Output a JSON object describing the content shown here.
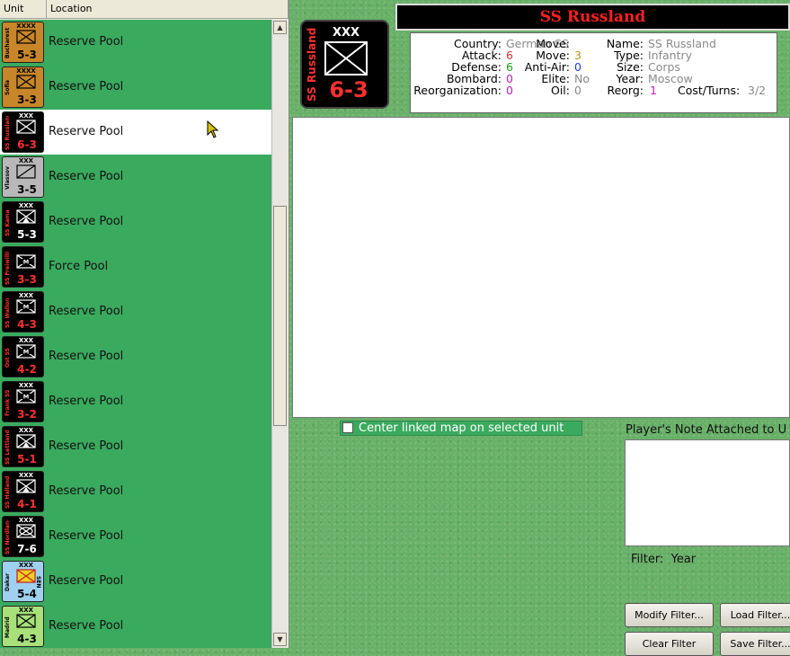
{
  "list": {
    "columns": {
      "unit": "Unit",
      "location": "Location"
    },
    "rows": [
      {
        "location": "Reserve Pool",
        "counter": {
          "name": "Bucharest",
          "size": "XXXX",
          "str": "5-3",
          "side": "",
          "bg": "#c8862a",
          "fg": "#000000",
          "strColor": "#000000",
          "symbol": "infantry"
        }
      },
      {
        "location": "Reserve Pool",
        "counter": {
          "name": "Sofia",
          "size": "XXXX",
          "str": "3-3",
          "side": "",
          "bg": "#c8862a",
          "fg": "#000000",
          "strColor": "#000000",
          "symbol": "infantry"
        }
      },
      {
        "location": "Reserve Pool",
        "counter": {
          "name": "SS Russland",
          "size": "XXX",
          "str": "6-3",
          "side": "",
          "bg": "#000000",
          "fg": "#ffffff",
          "strColor": "#ff3030",
          "symbol": "infantry"
        }
      },
      {
        "location": "Reserve Pool",
        "counter": {
          "name": "Vlassov",
          "size": "XXX",
          "str": "3-5",
          "side": "",
          "bg": "#b8b8b8",
          "fg": "#000000",
          "strColor": "#000000",
          "symbol": "cavalry"
        }
      },
      {
        "location": "Reserve Pool",
        "counter": {
          "name": "SS Kama",
          "size": "XXX",
          "str": "5-3",
          "side": "",
          "bg": "#000000",
          "fg": "#ffffff",
          "strColor": "#ffffff",
          "symbol": "mountain"
        }
      },
      {
        "location": "Force Pool",
        "counter": {
          "name": "SS Freiwilli",
          "size": "",
          "str": "3-3",
          "side": "",
          "bg": "#000000",
          "fg": "#ffffff",
          "strColor": "#ff3030",
          "symbol": "motorized"
        }
      },
      {
        "location": "Reserve Pool",
        "counter": {
          "name": "SS Wallon",
          "size": "XXX",
          "str": "4-3",
          "side": "",
          "bg": "#000000",
          "fg": "#ffffff",
          "strColor": "#ff3030",
          "symbol": "motorized"
        }
      },
      {
        "location": "Reserve Pool",
        "counter": {
          "name": "Ost SS",
          "size": "XXX",
          "str": "4-2",
          "side": "",
          "bg": "#000000",
          "fg": "#ffffff",
          "strColor": "#ff3030",
          "symbol": "motorized"
        }
      },
      {
        "location": "Reserve Pool",
        "counter": {
          "name": "Frank SS",
          "size": "XXX",
          "str": "3-2",
          "side": "",
          "bg": "#000000",
          "fg": "#ffffff",
          "strColor": "#ff3030",
          "symbol": "motorized"
        }
      },
      {
        "location": "Reserve Pool",
        "counter": {
          "name": "SS Lettland",
          "size": "XXX",
          "str": "5-1",
          "side": "",
          "bg": "#000000",
          "fg": "#ffffff",
          "strColor": "#ff3030",
          "symbol": "mountain"
        }
      },
      {
        "location": "Reserve Pool",
        "counter": {
          "name": "SS Halland",
          "size": "XXX",
          "str": "4-1",
          "side": "",
          "bg": "#000000",
          "fg": "#ffffff",
          "strColor": "#ff3030",
          "symbol": "mountain"
        }
      },
      {
        "location": "Reserve Pool",
        "counter": {
          "name": "SS Nordland",
          "size": "XXX",
          "str": "7-6",
          "side": "",
          "bg": "#000000",
          "fg": "#ffffff",
          "strColor": "#ffffff",
          "symbol": "armor"
        }
      },
      {
        "location": "Reserve Pool",
        "counter": {
          "name": "Dakar",
          "size": "XXX",
          "str": "5-4",
          "side": "SEN",
          "bg": "#9fd0ef",
          "fg": "#000000",
          "strColor": "#000000",
          "symbol": "colonial"
        }
      },
      {
        "location": "Reserve Pool",
        "counter": {
          "name": "Madrid",
          "size": "XXX",
          "str": "4-3",
          "side": "",
          "bg": "#a8e07a",
          "fg": "#000000",
          "strColor": "#000000",
          "symbol": "infantry"
        }
      }
    ]
  },
  "selected": {
    "title": "SS Russland",
    "counter": {
      "name": "SS Russland",
      "size": "XXX",
      "str": "6-3"
    },
    "fields": {
      "country_label": "Country:",
      "country": "German SS",
      "attack_label": "Attack:",
      "attack": "6",
      "defense_label": "Defense:",
      "defense": "6",
      "bombard_label": "Bombard:",
      "bombard": "0",
      "reorg_label": "Reorganization:",
      "reorg": "0",
      "move_label": "Move:",
      "move": "3",
      "antiair_label": "Anti-Air:",
      "antiair": "0",
      "elite_label": "Elite:",
      "elite": "No",
      "oil_label": "Oil:",
      "oil": "0",
      "name_label": "Name:",
      "name": "SS Russland",
      "type_label": "Type:",
      "type": "Infantry",
      "size_label": "Size:",
      "size": "Corps",
      "year_label": "Year:",
      "year": "Moscow",
      "reorg2_label": "Reorg:",
      "reorg2": "1",
      "cost_label": "Cost/Turns:",
      "cost": "3/2"
    }
  },
  "center_link_label": "Center linked map on selected unit",
  "player_note_title": "Player's Note Attached to U",
  "filter": {
    "label": "Filter:",
    "value": "Year"
  },
  "buttons": {
    "modify": "Modify Filter...",
    "load": "Load Filter...",
    "clear": "Clear Filter",
    "save": "Save Filter..."
  },
  "colors": {
    "list_bg": "#3aaa5e",
    "attack": "#e03030",
    "defense": "#20a020",
    "move": "#c09020",
    "purple": "#c020c0",
    "blue": "#2040e0",
    "gray": "#8a8a8a"
  }
}
